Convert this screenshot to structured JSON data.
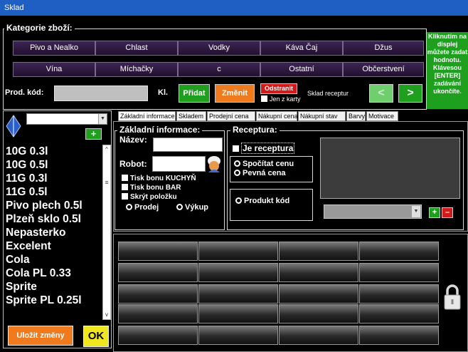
{
  "window": {
    "title": "Sklad"
  },
  "categories": {
    "legend": "Kategorie zboží:",
    "buttons": [
      "Pivo a Nealko",
      "Chlast",
      "Vodky",
      "Káva Čaj",
      "Džus",
      "Vína",
      "Míchačky",
      "c",
      "Ostatní",
      "Občerstvení"
    ]
  },
  "hint": {
    "text": "Kliknutím na displej můžete zadat hodnotu. Klávesou [ENTER] zadávání ukončíte."
  },
  "toolbar": {
    "prod_code_label": "Prod. kód:",
    "prod_code_value": "",
    "kl_label": "Kl.",
    "add_label": "Přidat",
    "change_label": "Změnit",
    "remove_label": "Odstranit",
    "only_card_label": "Jen z karty",
    "recipe_store_label": "Sklad receptur",
    "prev_label": "<",
    "next_label": ">"
  },
  "sidebar": {
    "add_label": "+",
    "items": [
      "10G 0.3l",
      "10G 0.5l",
      "11G 0.3l",
      "11G 0.5l",
      "Pivo plech 0.5l",
      "Plzeň sklo 0.5l",
      "Nepasterko",
      "Excelent",
      "Cola",
      "Cola PL 0.33",
      "Sprite",
      "Sprite PL 0.25l"
    ],
    "save_label": "Uložit změny",
    "ok_label": "OK"
  },
  "tabs": [
    "Základní informace",
    "Skladem",
    "Prodejní cena",
    "Nákupní cena",
    "Nákupní stav",
    "Barvy",
    "Motivace"
  ],
  "basic": {
    "legend": "Základní informace:",
    "name_label": "Název:",
    "name_value": "",
    "robot_label": "Robot:",
    "robot_value": "",
    "kitchen_label": "Tisk bonu KUCHYŇ",
    "bar_label": "Tisk bonu BAR",
    "hide_label": "Skrýt položku",
    "sale_label": "Prodej",
    "buyout_label": "Výkup"
  },
  "recipe": {
    "legend": "Receptura:",
    "is_recipe_label": "Je receptura",
    "calc_price_label": "Spočítat cenu",
    "fixed_price_label": "Pevná cena",
    "product_code_label": "Produkt kód",
    "select_value": "",
    "add_label": "+",
    "remove_label": "–"
  },
  "colors": {
    "titlebar": "#1f5fc4",
    "category": "#3c2554",
    "add": "#1ea01e",
    "change": "#f07a1e",
    "remove": "#d11a1a",
    "save": "#f07a1e",
    "ok": "#f0e61e"
  }
}
